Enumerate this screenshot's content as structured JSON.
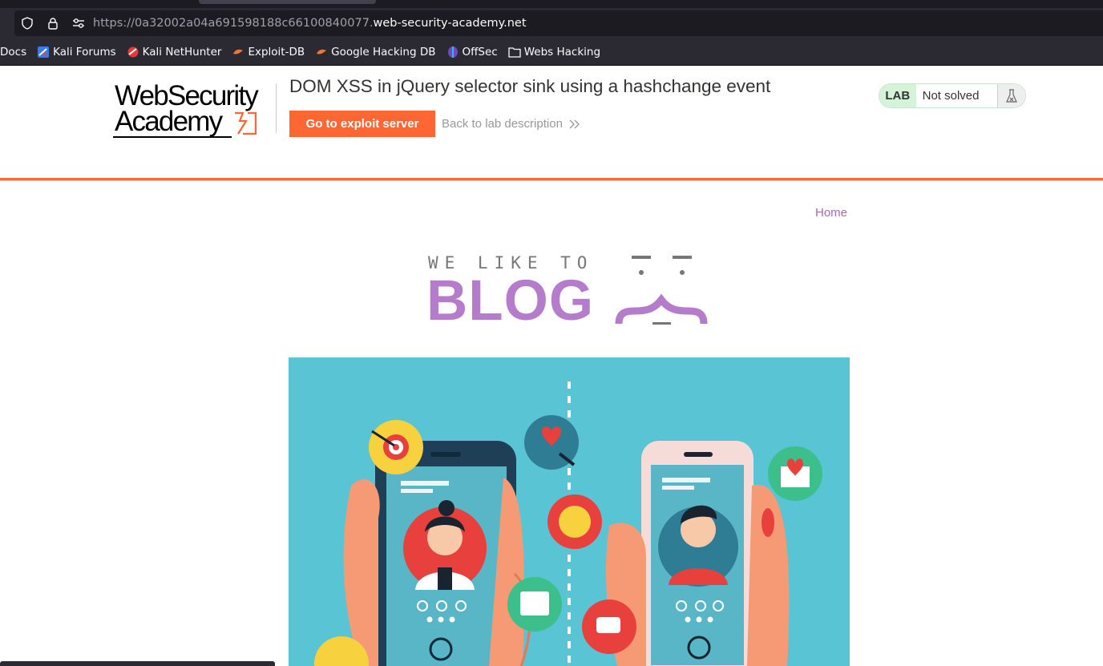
{
  "browser": {
    "url_prefix": "https://0a32002a04a691598188c66100840077.",
    "url_domain": "web-security-academy.net",
    "icons": [
      "shield-icon",
      "lock-icon",
      "page-settings-icon"
    ],
    "bookmarks": [
      {
        "label": "Docs",
        "icon": ""
      },
      {
        "label": "Kali Forums",
        "icon": "kali-forums-favicon"
      },
      {
        "label": "Kali NetHunter",
        "icon": "nethunter-favicon"
      },
      {
        "label": "Exploit-DB",
        "icon": "exploitdb-favicon"
      },
      {
        "label": "Google Hacking DB",
        "icon": "ghdb-favicon"
      },
      {
        "label": "OffSec",
        "icon": "offsec-favicon"
      },
      {
        "label": "Webs Hacking",
        "icon": "folder-icon"
      }
    ]
  },
  "lab": {
    "logo_line1": "WebSecurity",
    "logo_line2": "Academy",
    "title": "DOM XSS in jQuery selector sink using a hashchange event",
    "exploit_button": "Go to exploit server",
    "back_link": "Back to lab description",
    "status_badge": "LAB",
    "status_text": "Not solved",
    "colors": {
      "accent": "#ff6633",
      "badge_bg": "#d4f3d9",
      "blog_purple": "#b57ccb",
      "hero_bg": "#58c4d4"
    }
  },
  "blog": {
    "nav_home": "Home",
    "banner_tagline": "WE LIKE TO",
    "banner_word": "BLOG"
  }
}
